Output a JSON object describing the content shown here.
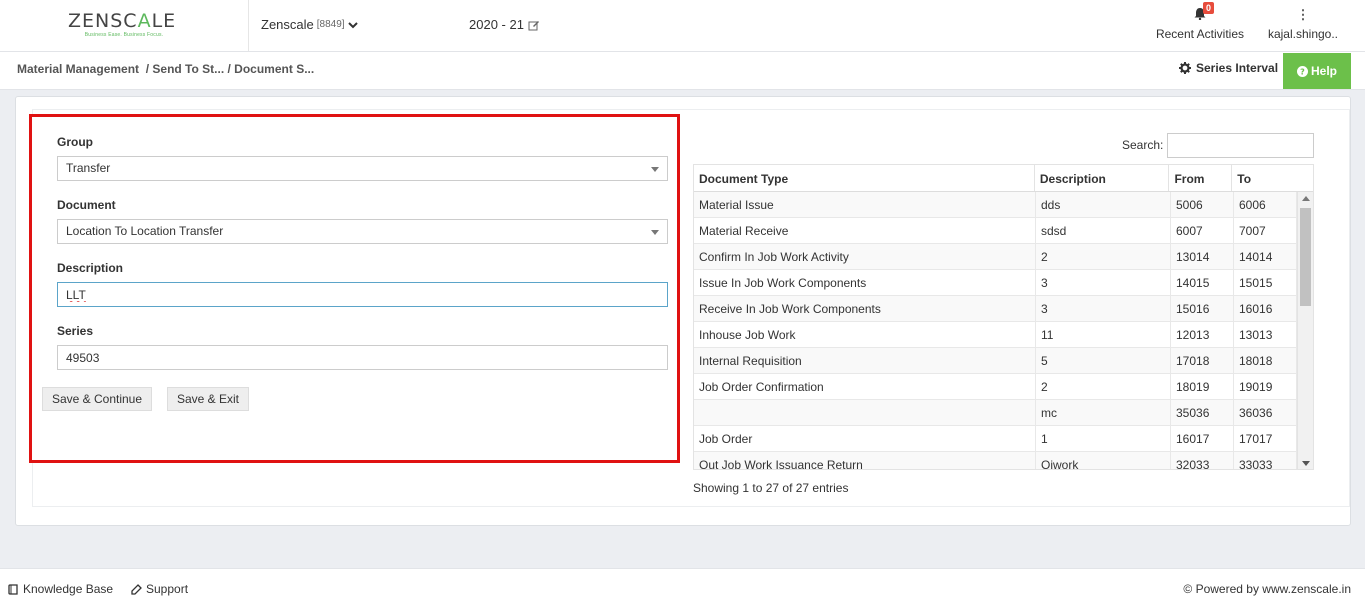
{
  "header": {
    "logo_text": "ZENSCALE",
    "logo_tagline": "Business Ease. Business Focus.",
    "company": "Zenscale",
    "company_code": "[8849]",
    "financial_year": "2020 - 21",
    "notifications_count": "0",
    "recent_activities_label": "Recent Activities",
    "user_name": "kajal.shingo.."
  },
  "breadcrumb": {
    "items": [
      "Material Management",
      "/ Send To St...",
      "/ Document S..."
    ]
  },
  "toolbar": {
    "series_interval_label": "Series Interval",
    "help_label": "Help"
  },
  "form": {
    "group_label": "Group",
    "group_value": "Transfer",
    "document_label": "Document",
    "document_value": "Location To Location Transfer",
    "description_label": "Description",
    "description_value": "LLT",
    "series_label": "Series",
    "series_value": "49503",
    "save_continue_label": "Save & Continue",
    "save_exit_label": "Save & Exit"
  },
  "table": {
    "search_label": "Search:",
    "headers": [
      "Document Type",
      "Description",
      "From",
      "To"
    ],
    "rows": [
      [
        "Material Issue",
        "dds",
        "5006",
        "6006"
      ],
      [
        "Material Receive",
        "sdsd",
        "6007",
        "7007"
      ],
      [
        "Confirm In Job Work Activity",
        "2",
        "13014",
        "14014"
      ],
      [
        "Issue In Job Work Components",
        "3",
        "14015",
        "15015"
      ],
      [
        "Receive In Job Work Components",
        "3",
        "15016",
        "16016"
      ],
      [
        "Inhouse Job Work",
        "11",
        "12013",
        "13013"
      ],
      [
        "Internal Requisition",
        "5",
        "17018",
        "18018"
      ],
      [
        "Job Order Confirmation",
        "2",
        "18019",
        "19019"
      ],
      [
        "",
        "mc",
        "35036",
        "36036"
      ],
      [
        "Job Order",
        "1",
        "16017",
        "17017"
      ],
      [
        "Out Job Work Issuance Return",
        "Ojwork",
        "32033",
        "33033"
      ]
    ],
    "info": "Showing 1 to 27 of 27 entries"
  },
  "footer": {
    "knowledge_base": "Knowledge Base",
    "support": "Support",
    "powered_by": "© Powered by www.zenscale.in"
  },
  "colors": {
    "accent_green": "#6cc04a",
    "highlight_red": "#e01212",
    "badge_red": "#e74c3c"
  }
}
